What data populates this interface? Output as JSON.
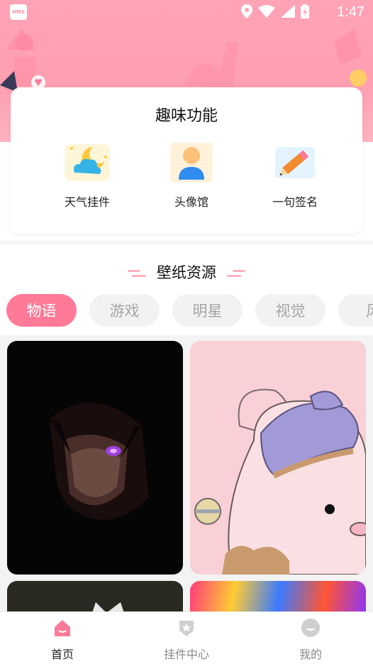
{
  "status_bar": {
    "time": "1:47",
    "badge_text": "HMS"
  },
  "fun_section": {
    "title": "趣味功能",
    "items": [
      {
        "label": "天气挂件",
        "icon": "weather-icon"
      },
      {
        "label": "头像馆",
        "icon": "avatar-icon"
      },
      {
        "label": "一句签名",
        "icon": "pencil-icon"
      }
    ]
  },
  "wallpaper_section": {
    "title": "壁纸资源",
    "tabs": [
      "物语",
      "游戏",
      "明星",
      "视觉",
      "风"
    ],
    "active_tab": "物语"
  },
  "bottom_nav": {
    "items": [
      {
        "label": "首页",
        "icon": "home-icon",
        "active": true
      },
      {
        "label": "挂件中心",
        "icon": "badge-icon",
        "active": false
      },
      {
        "label": "我的",
        "icon": "profile-icon",
        "active": false
      }
    ]
  },
  "colors": {
    "accent": "#ff7a97",
    "banner": "#ffa3b6"
  }
}
